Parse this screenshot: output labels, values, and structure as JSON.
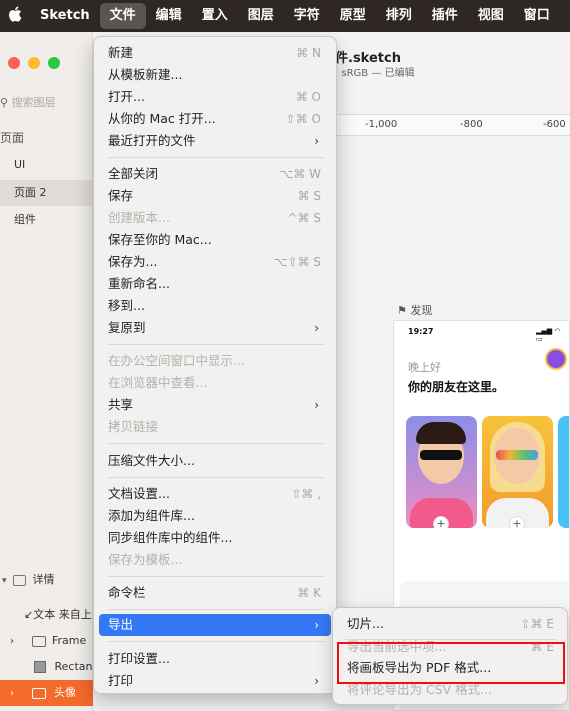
{
  "menubar": {
    "apple": "",
    "items": [
      "Sketch",
      "文件",
      "编辑",
      "置入",
      "图层",
      "字符",
      "原型",
      "排列",
      "插件",
      "视图",
      "窗口"
    ]
  },
  "document": {
    "title": "件.sketch",
    "subtitle": "· sRGB — 已编辑"
  },
  "sidebar": {
    "search_placeholder": "搜索图层",
    "pages_header": "页面",
    "pages": [
      "UI",
      "页面 2",
      "组件"
    ],
    "details_header": "详情",
    "layers": [
      "↙文本 来自上",
      "Frame",
      "Rectan",
      "头像"
    ]
  },
  "ruler": {
    "ticks": [
      "-1,000",
      "-800",
      "-600"
    ]
  },
  "artboard": {
    "label": "发现",
    "time": "19:27",
    "greeting": "晚上好",
    "headline": "你的朋友在这里。"
  },
  "file_menu": {
    "items": [
      {
        "label": "新建",
        "shortcut": "⌘ N",
        "enabled": true
      },
      {
        "label": "从模板新建...",
        "shortcut": "",
        "enabled": true
      },
      {
        "label": "打开...",
        "shortcut": "⌘ O",
        "enabled": true
      },
      {
        "label": "从你的 Mac 打开...",
        "shortcut": "⇧⌘ O",
        "enabled": true
      },
      {
        "label": "最近打开的文件",
        "shortcut": "",
        "enabled": true,
        "submenu": true
      },
      {
        "label": "全部关闭",
        "shortcut": "⌥⌘ W",
        "enabled": true
      },
      {
        "label": "保存",
        "shortcut": "⌘ S",
        "enabled": true
      },
      {
        "label": "创建版本...",
        "shortcut": "^⌘ S",
        "enabled": false
      },
      {
        "label": "保存至你的 Mac...",
        "shortcut": "",
        "enabled": true
      },
      {
        "label": "保存为...",
        "shortcut": "⌥⇧⌘ S",
        "enabled": true
      },
      {
        "label": "重新命名...",
        "shortcut": "",
        "enabled": true
      },
      {
        "label": "移到...",
        "shortcut": "",
        "enabled": true
      },
      {
        "label": "复原到",
        "shortcut": "",
        "enabled": true,
        "submenu": true
      },
      {
        "label": "在办公空间窗口中显示...",
        "shortcut": "",
        "enabled": false
      },
      {
        "label": "在浏览器中查看...",
        "shortcut": "",
        "enabled": false
      },
      {
        "label": "共享",
        "shortcut": "",
        "enabled": true,
        "submenu": true
      },
      {
        "label": "拷贝链接",
        "shortcut": "",
        "enabled": false
      },
      {
        "label": "压缩文件大小...",
        "shortcut": "",
        "enabled": true
      },
      {
        "label": "文档设置...",
        "shortcut": "⇧⌘ ,",
        "enabled": true
      },
      {
        "label": "添加为组件库...",
        "shortcut": "",
        "enabled": true
      },
      {
        "label": "同步组件库中的组件...",
        "shortcut": "",
        "enabled": true
      },
      {
        "label": "保存为模板...",
        "shortcut": "",
        "enabled": false
      },
      {
        "label": "命令栏",
        "shortcut": "⌘ K",
        "enabled": true
      },
      {
        "label": "导出",
        "shortcut": "",
        "enabled": true,
        "submenu": true,
        "highlighted": true
      },
      {
        "label": "打印设置...",
        "shortcut": "",
        "enabled": true
      },
      {
        "label": "打印",
        "shortcut": "",
        "enabled": true,
        "submenu": true
      }
    ]
  },
  "export_submenu": {
    "items": [
      {
        "label": "切片...",
        "shortcut": "⇧⌘ E",
        "enabled": true
      },
      {
        "label": "导出当前选中项...",
        "shortcut": "⌘ E",
        "enabled": false
      },
      {
        "label": "将画板导出为 PDF 格式...",
        "shortcut": "",
        "enabled": true
      },
      {
        "label": "将评论导出为 CSV 格式...",
        "shortcut": "",
        "enabled": false
      }
    ]
  },
  "colors": {
    "accent": "#3478f6",
    "selection": "#f46a2b",
    "annotation": "#e11111"
  }
}
